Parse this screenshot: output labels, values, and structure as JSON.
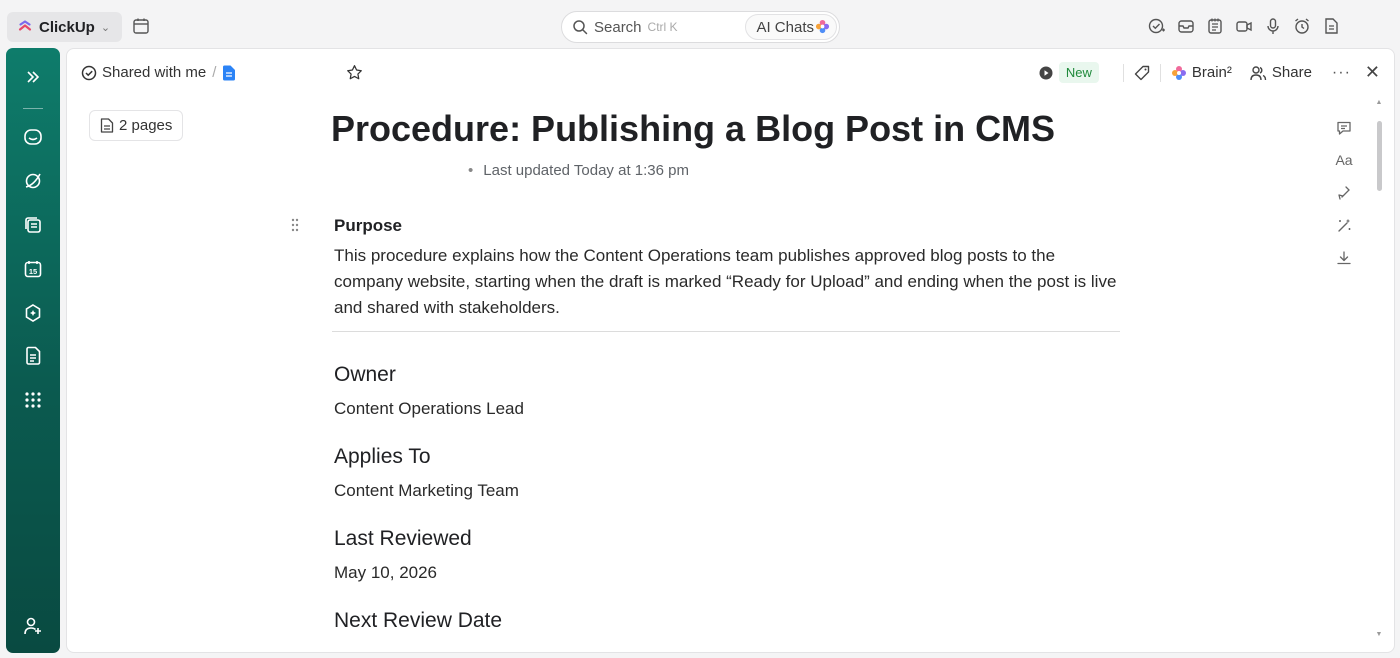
{
  "topbar": {
    "app_name": "ClickUp",
    "search_label": "Search",
    "search_shortcut": "Ctrl K",
    "ai_chats_label": "AI Chats"
  },
  "rail": {
    "items": [
      "expand",
      "inbox",
      "planner",
      "docs-hub",
      "calendar",
      "ai-brain",
      "docs",
      "apps",
      "invite"
    ]
  },
  "header": {
    "breadcrumb_root": "Shared with me",
    "breadcrumb_sep": "/",
    "new_badge": "New",
    "brain_label": "Brain²",
    "share_label": "Share",
    "more_label": "···",
    "close_label": "✕"
  },
  "doc": {
    "pages_label": "2 pages",
    "title": "Procedure: Publishing a Blog Post in CMS",
    "updated_dot": "•",
    "last_updated": "Last updated Today at 1:36 pm",
    "purpose_heading": "Purpose",
    "purpose_text": "This procedure explains how the Content Operations team publishes approved blog posts to the company website, starting when the draft is marked “Ready for Upload” and ending when the post is live and shared with stakeholders.",
    "sections": [
      {
        "heading": "Owner",
        "text": "Content Operations Lead"
      },
      {
        "heading": "Applies To",
        "text": "Content Marketing Team"
      },
      {
        "heading": "Last Reviewed",
        "text": "May 10, 2026"
      },
      {
        "heading": "Next Review Date",
        "text": ""
      }
    ]
  },
  "side_tools": {
    "font_label": "Aa"
  },
  "colors": {
    "rail_top": "#0e7c6b",
    "rail_bottom": "#094a41",
    "new_badge_bg": "#e9f7ee",
    "new_badge_text": "#1f8a3b"
  }
}
